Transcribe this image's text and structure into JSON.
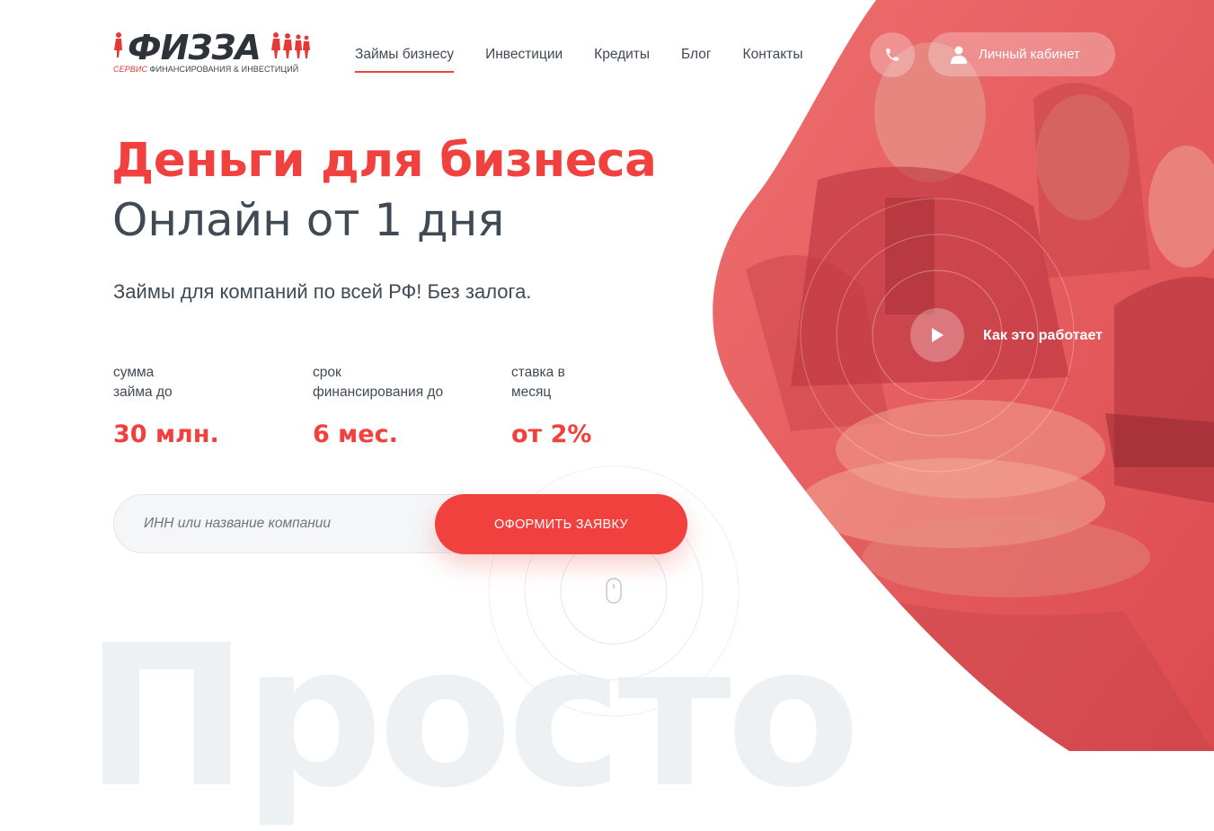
{
  "logo": {
    "name": "ФИЗЗА",
    "subtitle_accent": "СЕРВИС",
    "subtitle_rest": "ФИНАНСИРОВАНИЯ & ИНВЕСТИЦИЙ"
  },
  "nav": {
    "items": [
      "Займы бизнесу",
      "Инвестиции",
      "Кредиты",
      "Блог",
      "Контакты"
    ],
    "active_index": 0
  },
  "header": {
    "phone_icon": "phone-icon",
    "cabinet_label": "Личный кабинет",
    "cabinet_icon": "user-icon"
  },
  "hero": {
    "title": "Деньги для бизнеса",
    "subtitle": "Онлайн от 1 дня",
    "lead": "Займы для компаний по всей РФ! Без залога.",
    "stats": [
      {
        "label_line1": "сумма",
        "label_line2": "займа до",
        "value": "30 млн."
      },
      {
        "label_line1": "срок",
        "label_line2": "финансирования до",
        "value": "6 мес."
      },
      {
        "label_line1": "ставка в",
        "label_line2": "месяц",
        "value": "от 2%"
      }
    ],
    "form": {
      "placeholder": "ИНН или название компании",
      "value": "",
      "submit_label": "ОФОРМИТЬ ЗАЯВКУ"
    },
    "video_label": "Как это работает",
    "background_word": "Просто"
  },
  "colors": {
    "accent": "#f1413e",
    "text": "#3f4a55",
    "photo_overlay": "#e9575b"
  }
}
